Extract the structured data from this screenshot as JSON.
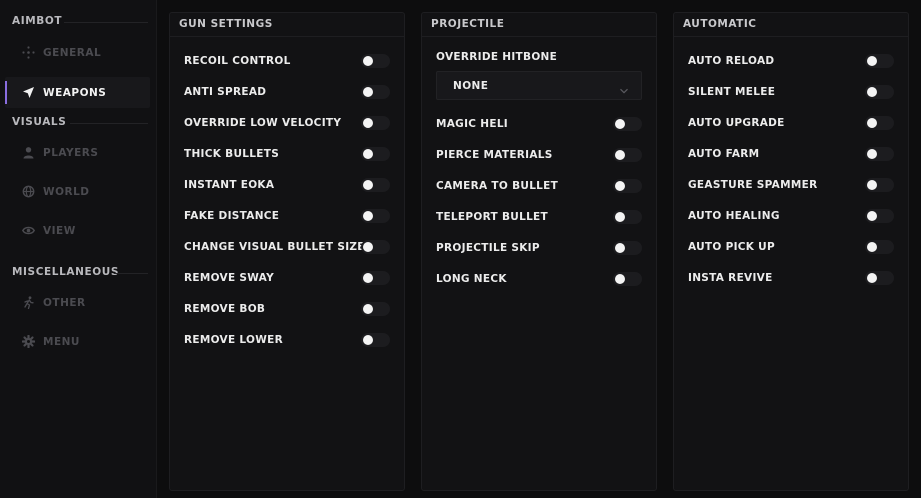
{
  "sidebar": {
    "sections": {
      "aimbot": "AIMBOT",
      "visuals": "VISUALS",
      "misc": "MISCELLANEOUS"
    },
    "items": {
      "general": "GENERAL",
      "weapons": "WEAPONS",
      "players": "PLAYERS",
      "world": "WORLD",
      "view": "VIEW",
      "other": "OTHER",
      "menu": "MENU"
    },
    "active": "WEAPONS"
  },
  "gun_settings": {
    "title": "GUN SETTINGS",
    "items": [
      {
        "label": "RECOIL CONTROL",
        "on": false
      },
      {
        "label": "ANTI SPREAD",
        "on": false
      },
      {
        "label": "OVERRIDE LOW VELOCITY",
        "on": false
      },
      {
        "label": "THICK BULLETS",
        "on": false
      },
      {
        "label": "INSTANT EOKA",
        "on": false
      },
      {
        "label": "FAKE DISTANCE",
        "on": false
      },
      {
        "label": "CHANGE VISUAL BULLET SIZE",
        "on": false
      },
      {
        "label": "REMOVE SWAY",
        "on": false
      },
      {
        "label": "REMOVE BOB",
        "on": false
      },
      {
        "label": "REMOVE LOWER",
        "on": false
      }
    ]
  },
  "projectile": {
    "title": "PROJECTILE",
    "hitbone_label": "OVERRIDE HITBONE",
    "hitbone_value": "NONE",
    "items": [
      {
        "label": "MAGIC HELI",
        "on": false
      },
      {
        "label": "PIERCE MATERIALS",
        "on": false
      },
      {
        "label": "CAMERA TO BULLET",
        "on": false
      },
      {
        "label": "TELEPORT BULLET",
        "on": false
      },
      {
        "label": "PROJECTILE SKIP",
        "on": false
      },
      {
        "label": "LONG NECK",
        "on": false
      }
    ]
  },
  "automatic": {
    "title": "AUTOMATIC",
    "items": [
      {
        "label": "AUTO RELOAD",
        "on": false
      },
      {
        "label": "SILENT MELEE",
        "on": false
      },
      {
        "label": "AUTO UPGRADE",
        "on": false
      },
      {
        "label": "AUTO FARM",
        "on": false
      },
      {
        "label": "GEASTURE SPAMMER",
        "on": false
      },
      {
        "label": "AUTO HEALING",
        "on": false
      },
      {
        "label": "AUTO PICK UP",
        "on": false
      },
      {
        "label": "INSTA REVIVE",
        "on": false
      }
    ]
  },
  "colors": {
    "background": "#0d0d0e",
    "panel": "#121214",
    "accent": "#8a6ee0",
    "toggle_track": "#1c1c1f",
    "toggle_knob": "#f4f4f4"
  }
}
